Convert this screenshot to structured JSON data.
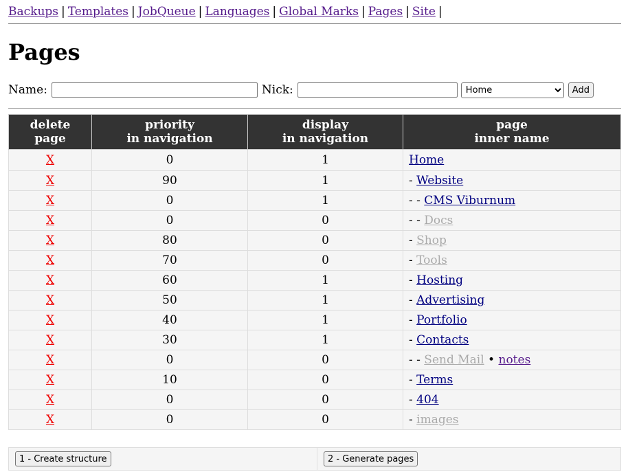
{
  "nav": {
    "links": [
      "Backups",
      "Templates",
      "JobQueue",
      "Languages",
      "Global Marks",
      "Pages",
      "Site"
    ],
    "separator": "|"
  },
  "page_title": "Pages",
  "add_form": {
    "name_label": "Name:",
    "name_value": "",
    "nick_label": "Nick:",
    "nick_value": "",
    "parent_selected": "Home",
    "add_label": "Add"
  },
  "table": {
    "headers": [
      [
        "delete",
        "page"
      ],
      [
        "priority",
        "in navigation"
      ],
      [
        "display",
        "in navigation"
      ],
      [
        "page",
        "inner name"
      ]
    ],
    "delete_label": "X",
    "rows": [
      {
        "priority": "0",
        "display": "1",
        "prefix": "",
        "name": "Home",
        "visible": true
      },
      {
        "priority": "90",
        "display": "1",
        "prefix": "- ",
        "name": "Website",
        "visible": true
      },
      {
        "priority": "0",
        "display": "1",
        "prefix": "- - ",
        "name": "CMS Viburnum",
        "visible": true
      },
      {
        "priority": "0",
        "display": "0",
        "prefix": "- - ",
        "name": "Docs",
        "visible": false
      },
      {
        "priority": "80",
        "display": "0",
        "prefix": "- ",
        "name": "Shop",
        "visible": false
      },
      {
        "priority": "70",
        "display": "0",
        "prefix": "- ",
        "name": "Tools",
        "visible": false
      },
      {
        "priority": "60",
        "display": "1",
        "prefix": "- ",
        "name": "Hosting",
        "visible": true
      },
      {
        "priority": "50",
        "display": "1",
        "prefix": "- ",
        "name": "Advertising",
        "visible": true
      },
      {
        "priority": "40",
        "display": "1",
        "prefix": "- ",
        "name": "Portfolio",
        "visible": true
      },
      {
        "priority": "30",
        "display": "1",
        "prefix": "- ",
        "name": "Contacts",
        "visible": true
      },
      {
        "priority": "0",
        "display": "0",
        "prefix": "- - ",
        "name": "Send Mail",
        "visible": false,
        "extra_sep": " • ",
        "extra_link": "notes"
      },
      {
        "priority": "10",
        "display": "0",
        "prefix": "- ",
        "name": "Terms",
        "visible": true
      },
      {
        "priority": "0",
        "display": "0",
        "prefix": "- ",
        "name": "404",
        "visible": true
      },
      {
        "priority": "0",
        "display": "0",
        "prefix": "- ",
        "name": "images",
        "visible": false
      }
    ]
  },
  "actions": {
    "create_structure": "1 - Create structure",
    "generate_pages": "2 - Generate pages"
  },
  "colors": {
    "header_bg": "#333333",
    "delete_link": "#ee0000",
    "visible_link": "#000080",
    "hidden_link": "#aaaaaa",
    "visited_link": "#551a8b"
  }
}
